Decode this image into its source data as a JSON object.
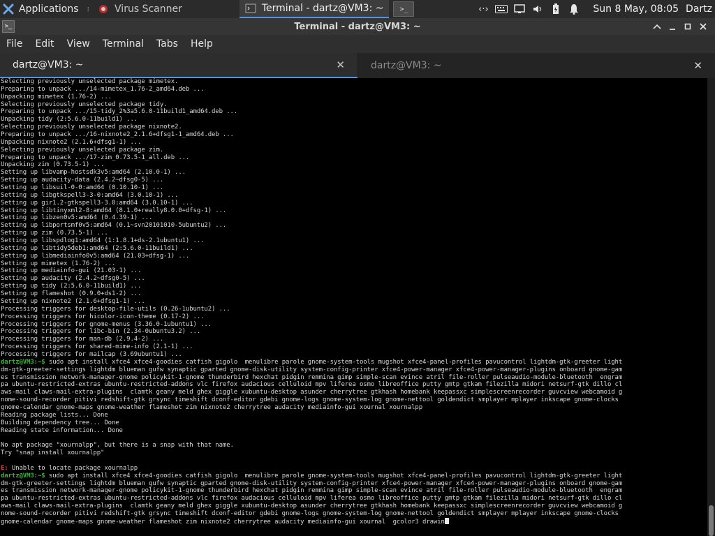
{
  "panel": {
    "applications_label": "Applications",
    "tasks": [
      {
        "label": "Virus Scanner",
        "active": false
      },
      {
        "label": "Terminal - dartz@VM3: ~",
        "active": true
      }
    ],
    "terminal_launcher_glyph": ">_",
    "tray_icons": [
      "network-icon",
      "keyboard-icon",
      "display-icon",
      "volume-icon",
      "battery-icon",
      "notification-bell-icon"
    ],
    "clock": "Sun  8 May, 08:05",
    "user": "Dartz"
  },
  "window": {
    "title": "Terminal - dartz@VM3: ~"
  },
  "menu": {
    "file": "File",
    "edit": "Edit",
    "view": "View",
    "terminal": "Terminal",
    "tabs": "Tabs",
    "help": "Help"
  },
  "tabs": [
    {
      "label": "dartz@VM3: ~",
      "active": true
    },
    {
      "label": "dartz@VM3: ~",
      "active": false
    }
  ],
  "terminal": {
    "lines": [
      "Selecting previously unselected package mimetex.",
      "Preparing to unpack .../14-mimetex_1.76-2_amd64.deb ...",
      "Unpacking mimetex (1.76-2) ...",
      "Selecting previously unselected package tidy.",
      "Preparing to unpack .../15-tidy_2%3a5.6.0-11build1_amd64.deb ...",
      "Unpacking tidy (2:5.6.0-11build1) ...",
      "Selecting previously unselected package nixnote2.",
      "Preparing to unpack .../16-nixnote2_2.1.6+dfsg1-1_amd64.deb ...",
      "Unpacking nixnote2 (2.1.6+dfsg1-1) ...",
      "Selecting previously unselected package zim.",
      "Preparing to unpack .../17-zim_0.73.5-1_all.deb ...",
      "Unpacking zim (0.73.5-1) ...",
      "Setting up libvamp-hostsdk3v5:amd64 (2.10.0-1) ...",
      "Setting up audacity-data (2.4.2~dfsg0-5) ...",
      "Setting up libsuil-0-0:amd64 (0.10.10-1) ...",
      "Setting up libgtkspell3-3-0:amd64 (3.0.10-1) ...",
      "Setting up gir1.2-gtkspell3-3.0:amd64 (3.0.10-1) ...",
      "Setting up libtinyxml2-8:amd64 (8.1.0+really8.0.0+dfsg-1) ...",
      "Setting up libzen0v5:amd64 (0.4.39-1) ...",
      "Setting up libportsmf0v5:amd64 (0.1~svn20101010-5ubuntu2) ...",
      "Setting up zim (0.73.5-1) ...",
      "Setting up libspdlog1:amd64 (1:1.8.1+ds-2.1ubuntu1) ...",
      "Setting up libtidy5deb1:amd64 (2:5.6.0-11build1) ...",
      "Setting up libmediainfo0v5:amd64 (21.03+dfsg-1) ...",
      "Setting up mimetex (1.76-2) ...",
      "Setting up mediainfo-gui (21.03-1) ...",
      "Setting up audacity (2.4.2~dfsg0-5) ...",
      "Setting up tidy (2:5.6.0-11build1) ...",
      "Setting up flameshot (0.9.0+ds1-2) ...",
      "Setting up nixnote2 (2.1.6+dfsg1-1) ...",
      "Processing triggers for desktop-file-utils (0.26-1ubuntu2) ...",
      "Processing triggers for hicolor-icon-theme (0.17-2) ...",
      "Processing triggers for gnome-menus (3.36.0-1ubuntu1) ...",
      "Processing triggers for libc-bin (2.34-0ubuntu3.2) ...",
      "Processing triggers for man-db (2.9.4-2) ...",
      "Processing triggers for shared-mime-info (2.1-1) ...",
      "Processing triggers for mailcap (3.69ubuntu1) ..."
    ],
    "prompt": "dartz@VM3:~$",
    "command1_lines": [
      " sudo apt install xfce4 xfce4-goodies catfish gigolo  menulibre parole gnome-system-tools mugshot xfce4-panel-profiles pavucontrol lightdm-gtk-greeter light",
      "dm-gtk-greeter-settings lightdm blueman gufw synaptic gparted gnome-disk-utility system-config-printer xfce4-power-manager xfce4-power-manager-plugins onboard gnome-gam",
      "es transmission network-manager-gnome policykit-1-gnome thunderbird hexchat pidgin remmina gimp simple-scan evince atril file-roller pulseaudio-module-bluetooth  engram",
      "pa ubuntu-restricted-extras ubuntu-restricted-addons vlc firefox audacious celluloid mpv liferea osmo libreoffice putty gmtp gtkam filezilla midori netsurf-gtk dillo cl",
      "aws-mail claws-mail-extra-plugins  clamtk geany meld ghex giggle xubuntu-desktop asunder cherrytree gtkhash homebank keepassxc simplescreenrecorder guvcview webcamoid g",
      "nome-sound-recorder pitivi redshift-gtk grsync timeshift dconf-editor gdebi gnome-logs gnome-system-log gnome-nettool goldendict smplayer mplayer inkscape gnome-clocks",
      "gnome-calendar gnome-maps gnome-weather flameshot zim nixnote2 cherrytree audacity mediainfo-gui xournal xournalpp"
    ],
    "output_lines": [
      "Reading package lists... Done",
      "Building dependency tree... Done",
      "Reading state information... Done",
      "",
      "No apt package \"xournalpp\", but there is a snap with that name.",
      "Try \"snap install xournalpp\"",
      ""
    ],
    "error_prefix": "E:",
    "error_text": " Unable to locate package xournalpp",
    "command2_lines": [
      " sudo apt install xfce4 xfce4-goodies catfish gigolo  menulibre parole gnome-system-tools mugshot xfce4-panel-profiles pavucontrol lightdm-gtk-greeter light",
      "dm-gtk-greeter-settings lightdm blueman gufw synaptic gparted gnome-disk-utility system-config-printer xfce4-power-manager xfce4-power-manager-plugins onboard gnome-gam",
      "es transmission network-manager-gnome policykit-1-gnome thunderbird hexchat pidgin remmina gimp simple-scan evince atril file-roller pulseaudio-module-bluetooth  engram",
      "pa ubuntu-restricted-extras ubuntu-restricted-addons vlc firefox audacious celluloid mpv liferea osmo libreoffice putty gmtp gtkam filezilla midori netsurf-gtk dillo cl",
      "aws-mail claws-mail-extra-plugins  clamtk geany meld ghex giggle xubuntu-desktop asunder cherrytree gtkhash homebank keepassxc simplescreenrecorder guvcview webcamoid g",
      "nome-sound-recorder pitivi redshift-gtk grsync timeshift dconf-editor gdebi gnome-logs gnome-system-log gnome-nettool goldendict smplayer mplayer inkscape gnome-clocks",
      "gnome-calendar gnome-maps gnome-weather flameshot zim nixnote2 cherrytree audacity mediainfo-gui xournal  gcolor3 drawin"
    ]
  }
}
